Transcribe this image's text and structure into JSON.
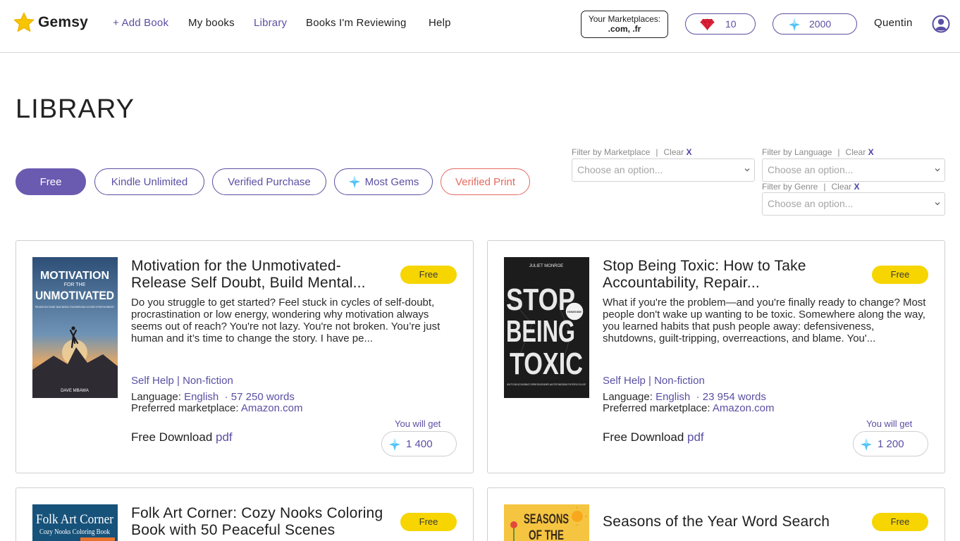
{
  "app": {
    "name": "Gemsy",
    "nav": {
      "add_book": "+ Add Book",
      "my_books": "My books",
      "library": "Library",
      "reviewing": "Books I'm Reviewing",
      "help": "Help"
    },
    "marketplaces": {
      "label": "Your Marketplaces:",
      "value": ".com, .fr"
    },
    "rubies": "10",
    "gems": "2000",
    "username": "Quentin",
    "colors": {
      "accent": "#5a4fa3",
      "badge": "#f6d500",
      "ruby": "#e0243a",
      "gem": "#4fc3f7",
      "verified_print": "#e46a5f"
    }
  },
  "page": {
    "title": "LIBRARY",
    "filter_pills": {
      "free": "Free",
      "kindle_unlimited": "Kindle Unlimited",
      "verified_purchase": "Verified Purchase",
      "most_gems": "Most Gems",
      "verified_print": "Verified Print"
    },
    "filters": {
      "marketplace": {
        "label": "Filter by Marketplace",
        "sep": "|",
        "clear": "Clear",
        "x": "X",
        "placeholder": "Choose an option..."
      },
      "language": {
        "label": "Filter by Language",
        "sep": "|",
        "clear": "Clear",
        "x": "X",
        "placeholder": "Choose an option..."
      },
      "genre": {
        "label": "Filter by Genre",
        "sep": "|",
        "clear": "Clear",
        "x": "X",
        "placeholder": "Choose an option..."
      }
    }
  },
  "books": [
    {
      "title": "Motivation for the Unmotivated- Release Self Doubt, Build Mental...",
      "badge": "Free",
      "description": "Do you struggle to get started? Feel stuck in cycles of self-doubt, procrastination or low energy, wondering why motivation always seems out of reach?  You're not lazy. You're not broken. You’re just human and it’s time to change the story. I have pe...",
      "genre": "Self Help | Non-fiction",
      "language_label": "Language:",
      "language": "English",
      "words": "· 57 250 words",
      "marketplace_label": "Preferred marketplace:",
      "marketplace": "Amazon.com",
      "download_label": "Free Download",
      "download_format": "pdf",
      "you_will_get": "You will get",
      "reward": "1 400",
      "cover": {
        "line1": "MOTIVATION",
        "line2": "FOR THE",
        "line3": "UNMOTIVATED",
        "tagline": "RELEASE SELF-DOUBT, BUILD MENTAL TOUGHNESS AND CULTIVATE A POSITIVE MINDSET",
        "author": "DAVE MBAWA"
      }
    },
    {
      "title": "Stop Being Toxic: How to Take Accountability, Repair...",
      "badge": "Free",
      "description": "What if you're the problem—and you're finally ready to change?  Most people don't wake up wanting to be toxic. Somewhere along the way, you learned habits that push people away: defensiveness, shutdowns, guilt-tripping, overreactions, and blame. You'...",
      "genre": "Self Help | Non-fiction",
      "language_label": "Language:",
      "language": "English",
      "words": "· 23 954 words",
      "marketplace_label": "Preferred marketplace:",
      "marketplace": "Amazon.com",
      "download_label": "Free Download",
      "download_format": "pdf",
      "you_will_get": "You will get",
      "reward": "1 200",
      "cover": {
        "author": "JULIET MONROE",
        "line1": "STOP",
        "line2": "BEING",
        "line3": "TOXIC",
        "seal": "5 BONUSES INSIDE",
        "tagline": "HOW TO TAKE ACCOUNTABILITY, REPAIR RELATIONSHIPS, AND STOP SABOTAGING THE PEOPLE YOU LOVE"
      }
    },
    {
      "title": "Folk Art Corner: Cozy Nooks Coloring Book with 50 Peaceful Scenes",
      "badge": "Free",
      "cover": {
        "line1": "Folk Art Corner",
        "line2": "Cozy Nooks Coloring Book"
      }
    },
    {
      "title": "Seasons of the Year Word Search",
      "badge": "Free",
      "cover": {
        "line1": "SEASONS",
        "line2": "OF THE"
      }
    }
  ]
}
